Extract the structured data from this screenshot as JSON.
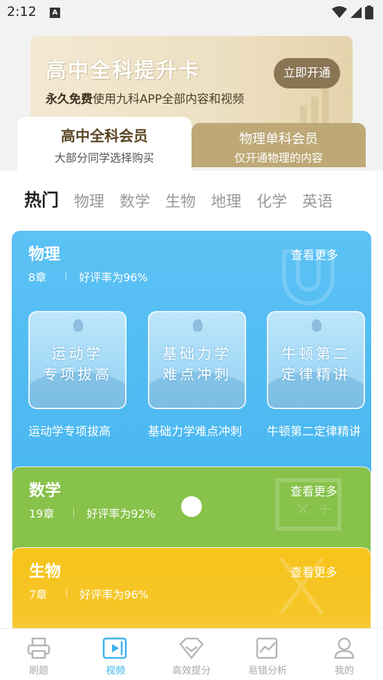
{
  "status_bar": {
    "time": "2:12",
    "notif_icon": "A"
  },
  "promo": {
    "title": "高中全科提升卡",
    "sub_bold": "永久免费",
    "sub_rest": "使用九科APP全部内容和视频",
    "button": "立即开通"
  },
  "membership_tabs": [
    {
      "title": "高中全科会员",
      "subtitle": "大部分同学选择购买"
    },
    {
      "title": "物理单科会员",
      "subtitle": "仅开通物理的内容"
    }
  ],
  "subject_tabs": [
    "热门",
    "物理",
    "数学",
    "生物",
    "地理",
    "化学",
    "英语"
  ],
  "cards": {
    "physics": {
      "title": "物理",
      "chapters": "8章",
      "rating": "好评率为96%",
      "more": "查看更多",
      "courses": [
        {
          "line1": "运动学",
          "line2": "专项拔高",
          "label": "运动学专项拔高"
        },
        {
          "line1": "基础力学",
          "line2": "难点冲刺",
          "label": "基础力学难点冲刺"
        },
        {
          "line1": "牛顿第二",
          "line2": "定律精讲",
          "label": "牛顿第二定律精讲"
        }
      ]
    },
    "math": {
      "title": "数学",
      "chapters": "19章",
      "rating": "好评率为92%",
      "more": "查看更多"
    },
    "biology": {
      "title": "生物",
      "chapters": "7章",
      "rating": "好评率为96%",
      "more": "查看更多"
    }
  },
  "bottom_nav": [
    {
      "label": "刷题",
      "icon": "printer-icon"
    },
    {
      "label": "视频",
      "icon": "video-icon"
    },
    {
      "label": "高效提分",
      "icon": "diamond-icon"
    },
    {
      "label": "易错分析",
      "icon": "chart-icon"
    },
    {
      "label": "我的",
      "icon": "user-icon"
    }
  ],
  "colors": {
    "physics": "#49b7f0",
    "math": "#87c24a",
    "biology": "#f6c62a",
    "accent": "#3db1ee",
    "gold": "#bda876"
  }
}
